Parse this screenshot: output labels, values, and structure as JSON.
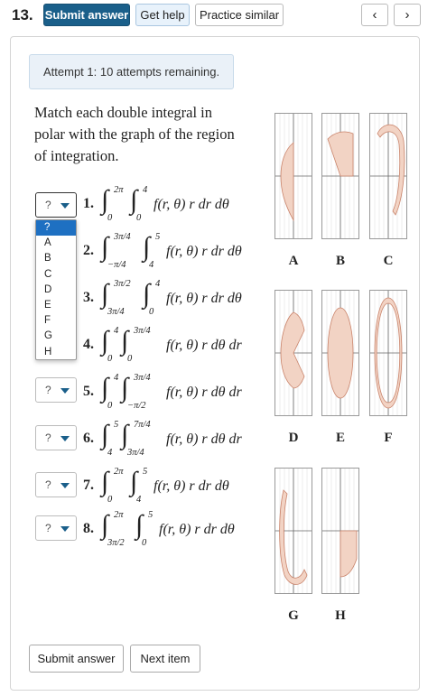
{
  "header": {
    "question_number": "13.",
    "submit_label": "Submit answer",
    "help_label": "Get help",
    "practice_label": "Practice similar",
    "prev_icon": "‹",
    "next_icon": "›"
  },
  "attempt_text": "Attempt 1: 10 attempts remaining.",
  "prompt_lines": [
    "Match each double integral in",
    "polar with the graph of the region",
    "of integration."
  ],
  "selects": [
    {
      "value": "?"
    },
    {
      "value": "?"
    },
    {
      "value": "?"
    },
    {
      "value": "?"
    },
    {
      "value": "?"
    },
    {
      "value": "?"
    },
    {
      "value": "?"
    },
    {
      "value": "?"
    }
  ],
  "dropdown_options": [
    "?",
    "A",
    "B",
    "C",
    "D",
    "E",
    "F",
    "G",
    "H"
  ],
  "integrals": [
    {
      "num": "1.",
      "outer_upper": "2π",
      "outer_lower": "0",
      "inner_upper": "4",
      "inner_lower": "0",
      "body": "f(r, θ) r dr dθ"
    },
    {
      "num": "2.",
      "outer_upper": "3π/4",
      "outer_lower": "−π/4",
      "inner_upper": "5",
      "inner_lower": "4",
      "body": "f(r, θ) r dr dθ"
    },
    {
      "num": "3.",
      "outer_upper": "3π/2",
      "outer_lower": "3π/4",
      "inner_upper": "4",
      "inner_lower": "0",
      "body": "f(r, θ) r dr dθ"
    },
    {
      "num": "4.",
      "outer_upper": "4",
      "outer_lower": "0",
      "inner_upper": "3π/4",
      "inner_lower": "0",
      "body": "f(r, θ) r dθ dr"
    },
    {
      "num": "5.",
      "outer_upper": "4",
      "outer_lower": "0",
      "inner_upper": "3π/4",
      "inner_lower": "−π/2",
      "body": "f(r, θ) r dθ dr"
    },
    {
      "num": "6.",
      "outer_upper": "5",
      "outer_lower": "4",
      "inner_upper": "7π/4",
      "inner_lower": "3π/4",
      "body": "f(r, θ) r dθ dr"
    },
    {
      "num": "7.",
      "outer_upper": "2π",
      "outer_lower": "0",
      "inner_upper": "5",
      "inner_lower": "4",
      "body": "f(r, θ) r dr dθ"
    },
    {
      "num": "8.",
      "outer_upper": "2π",
      "outer_lower": "3π/2",
      "inner_upper": "5",
      "inner_lower": "0",
      "body": "f(r, θ) r dr dθ"
    }
  ],
  "graph_labels": [
    "A",
    "B",
    "C",
    "D",
    "E",
    "F",
    "G",
    "H"
  ],
  "colors": {
    "region_fill": "#f2d3c4",
    "region_stroke": "#c9836a",
    "primary_button": "#1a5f8a",
    "dropdown_highlight": "#1e70c2"
  },
  "footer": {
    "submit_label": "Submit answer",
    "next_label": "Next item"
  }
}
